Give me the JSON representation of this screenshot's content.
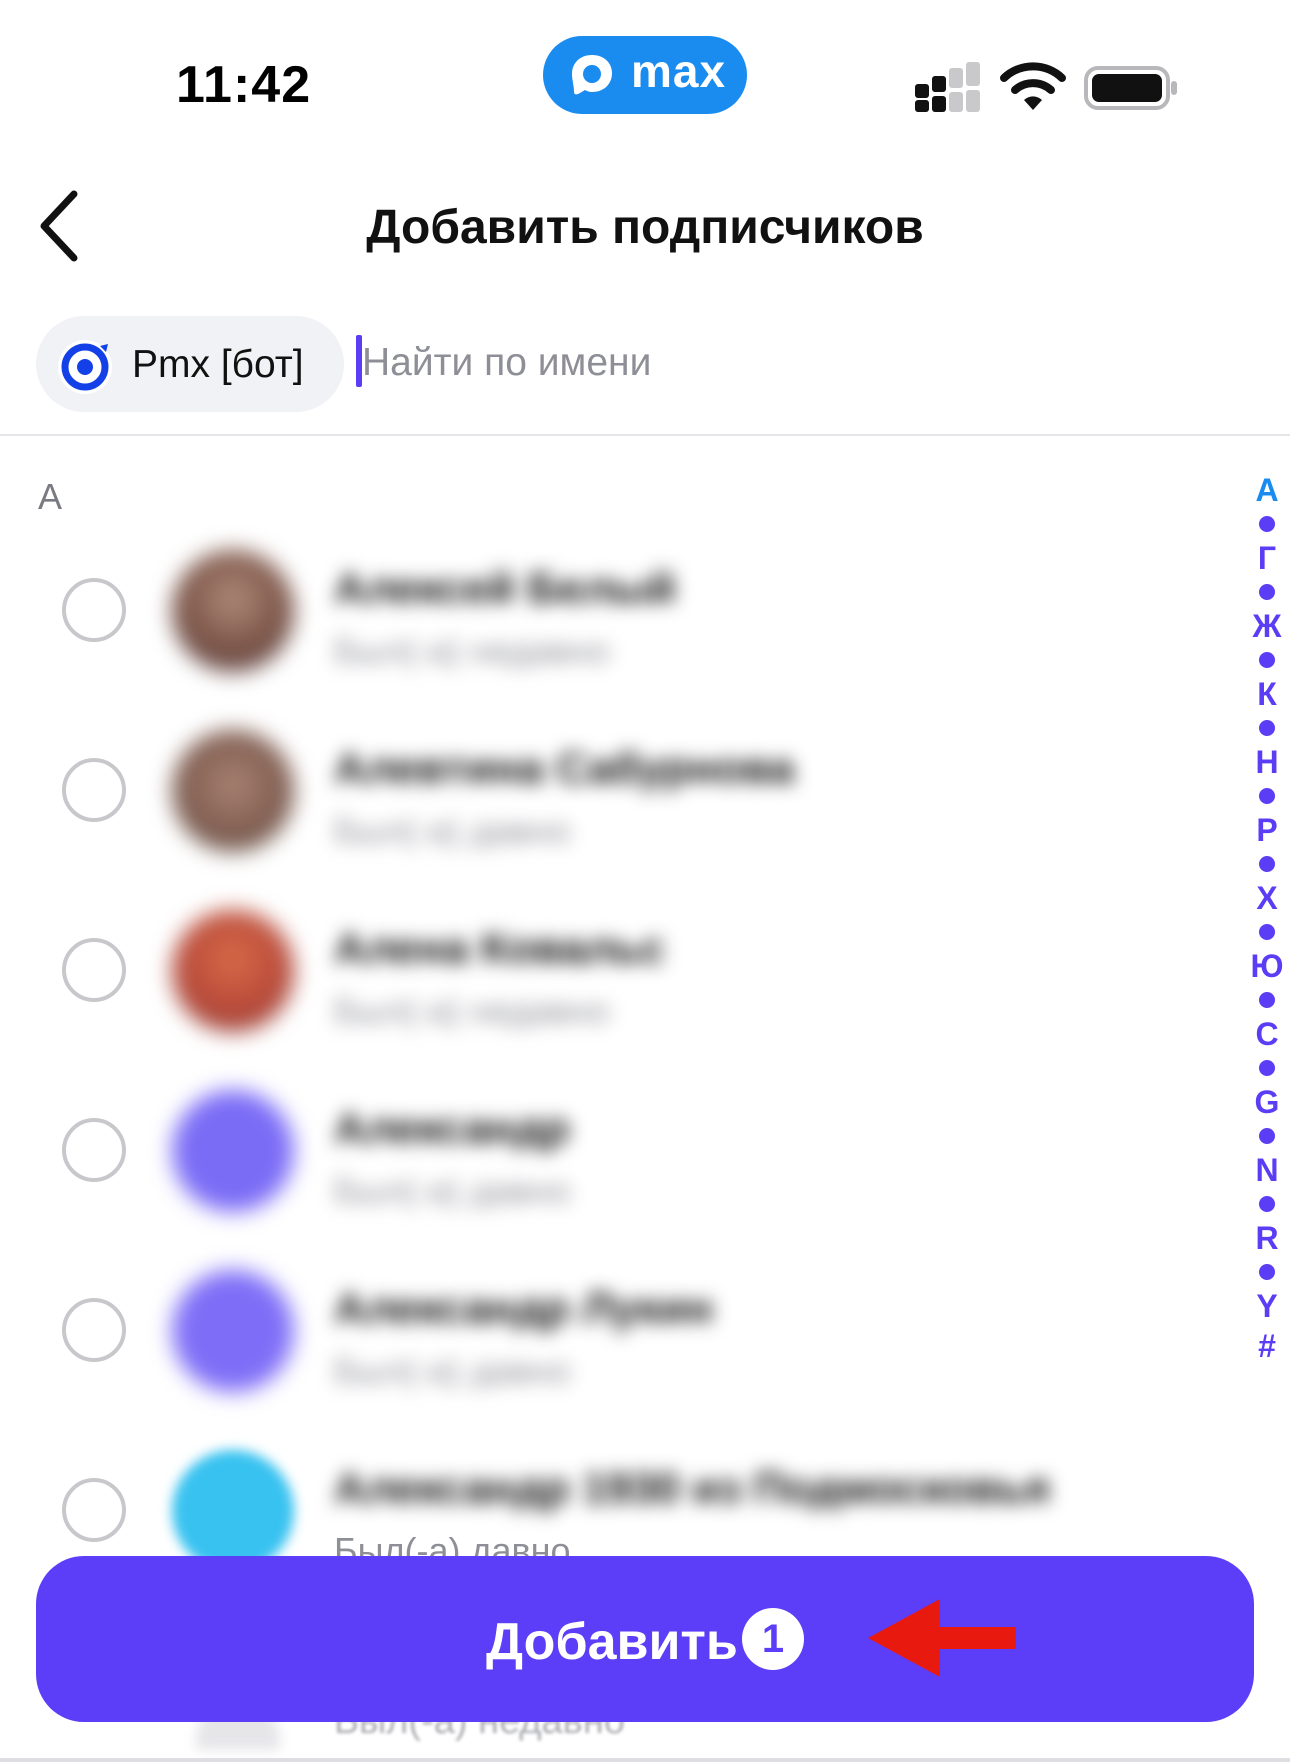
{
  "status_bar": {
    "time": "11:42",
    "app_badge": "max",
    "app_badge_color": "#1a8cf0"
  },
  "header": {
    "back_icon": "chevron-left-icon",
    "title": "Добавить подписчиков"
  },
  "selected_chips": [
    {
      "label": "Pmx [бот]",
      "icon": "bot-target-icon",
      "icon_color": "#1440e8"
    }
  ],
  "search": {
    "placeholder": "Найти по имени",
    "value": ""
  },
  "sections": [
    {
      "letter": "А",
      "contacts": [
        {
          "name": "Алексей Белый",
          "status": "Был(-а) недавно",
          "selected": false
        },
        {
          "name": "Алевтина Сабурнова",
          "status": "Был(-а) давно",
          "selected": false
        },
        {
          "name": "Алена Ковальс",
          "status": "Был(-а) недавно",
          "selected": false
        },
        {
          "name": "Александр",
          "status": "Был(-а) давно",
          "selected": false
        },
        {
          "name": "Александр Лукин",
          "status": "Был(-а) давно",
          "selected": false
        },
        {
          "name": "Александр 1930 из Подмосковья",
          "status": "Был(-а) давно",
          "selected": false
        }
      ]
    }
  ],
  "faded_row_status": "Был(-а) недавно",
  "alphabet_index": [
    "А",
    "Г",
    "Ж",
    "К",
    "Н",
    "Р",
    "Х",
    "Ю",
    "C",
    "G",
    "N",
    "R",
    "Y",
    "#"
  ],
  "add_button": {
    "label": "Добавить",
    "count": "1",
    "color": "#5c3ef8"
  },
  "annotation": {
    "arrow_color": "#e8190f"
  }
}
